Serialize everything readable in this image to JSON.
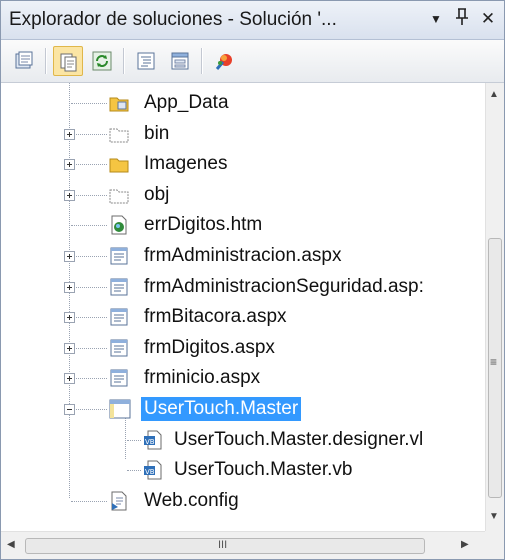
{
  "window": {
    "title": "Explorador de soluciones - Solución '...",
    "dropdown_icon": "▼",
    "pin_icon": "ᚹ",
    "close_icon": "✕"
  },
  "toolbar": {
    "buttons": [
      {
        "name": "properties-button",
        "icon": "properties-icon"
      },
      {
        "name": "show-all-files-button",
        "icon": "show-all-files-icon",
        "active": true
      },
      {
        "name": "refresh-button",
        "icon": "refresh-icon"
      },
      {
        "name": "view-code-button",
        "icon": "view-code-icon"
      },
      {
        "name": "view-designer-button",
        "icon": "view-designer-icon"
      },
      {
        "name": "aspnet-config-button",
        "icon": "aspnet-config-icon"
      }
    ]
  },
  "tree": {
    "items": [
      {
        "label": "App_Data",
        "icon": "folder-data-icon",
        "expander": "none"
      },
      {
        "label": "bin",
        "icon": "folder-hidden-icon",
        "expander": "plus"
      },
      {
        "label": "Imagenes",
        "icon": "folder-icon",
        "expander": "plus"
      },
      {
        "label": "obj",
        "icon": "folder-hidden-icon",
        "expander": "plus"
      },
      {
        "label": "errDigitos.htm",
        "icon": "html-file-icon",
        "expander": "none"
      },
      {
        "label": "frmAdministracion.aspx",
        "icon": "aspx-file-icon",
        "expander": "plus"
      },
      {
        "label": "frmAdministracionSeguridad.asp:",
        "icon": "aspx-file-icon",
        "expander": "plus"
      },
      {
        "label": "frmBitacora.aspx",
        "icon": "aspx-file-icon",
        "expander": "plus"
      },
      {
        "label": "frmDigitos.aspx",
        "icon": "aspx-file-icon",
        "expander": "plus"
      },
      {
        "label": "frminicio.aspx",
        "icon": "aspx-file-icon",
        "expander": "plus"
      },
      {
        "label": "UserTouch.Master",
        "icon": "master-page-icon",
        "expander": "minus",
        "selected": true
      },
      {
        "label": "UserTouch.Master.designer.vl",
        "icon": "vb-file-icon",
        "expander": "none",
        "child": true
      },
      {
        "label": "UserTouch.Master.vb",
        "icon": "vb-file-icon",
        "expander": "none",
        "child": true
      },
      {
        "label": "Web.config",
        "icon": "config-file-icon",
        "expander": "none"
      }
    ]
  },
  "scrollbars": {
    "horizontal_grip": "III",
    "vertical_grip": "≡",
    "up_arrow": "▲",
    "down_arrow": "▼",
    "left_arrow": "◀",
    "right_arrow": "▶"
  },
  "colors": {
    "selection": "#3399ff",
    "folder": "#f5c542",
    "tree_lines": "#9aa3b2"
  }
}
